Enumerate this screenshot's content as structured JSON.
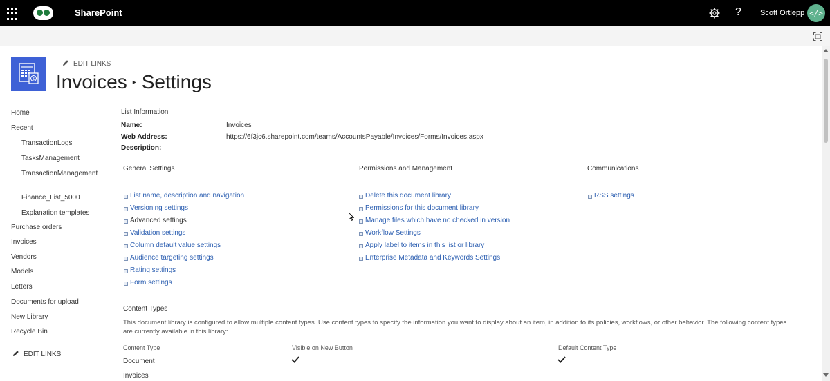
{
  "suite": {
    "app_name": "SharePoint",
    "user_name": "Scott Ortlepp",
    "avatar_glyph": "</>",
    "avatar_color": "#5fb28e"
  },
  "header": {
    "edit_links": "EDIT LINKS",
    "title_parent": "Invoices",
    "title_separator": "▸",
    "title_current": "Settings",
    "site_logo_color": "#3e61d6"
  },
  "nav": {
    "items": [
      {
        "label": "Home"
      },
      {
        "label": "Recent"
      },
      {
        "label": "TransactionLogs"
      },
      {
        "label": "TasksManagement"
      },
      {
        "label": "TransactionManagement"
      },
      {
        "label": "Finance_List_5000"
      },
      {
        "label": "Explanation templates"
      },
      {
        "label": "Purchase orders"
      },
      {
        "label": "Invoices"
      },
      {
        "label": "Vendors"
      },
      {
        "label": "Models"
      },
      {
        "label": "Letters"
      },
      {
        "label": "Documents for upload"
      },
      {
        "label": "New Library"
      },
      {
        "label": "Recycle Bin"
      }
    ],
    "edit_links": "EDIT LINKS"
  },
  "list_info": {
    "title": "List Information",
    "name_label": "Name:",
    "name_value": "Invoices",
    "web_label": "Web Address:",
    "web_value": "https://6f3jc6.sharepoint.com/teams/AccountsPayable/Invoices/Forms/Invoices.aspx",
    "desc_label": "Description:"
  },
  "general_settings": {
    "title": "General Settings",
    "links": [
      "List name, description and navigation",
      "Versioning settings",
      "Advanced settings",
      "Validation settings",
      "Column default value settings",
      "Audience targeting settings",
      "Rating settings",
      "Form settings"
    ]
  },
  "permissions": {
    "title": "Permissions and Management",
    "links": [
      "Delete this document library",
      "Permissions for this document library",
      "Manage files which have no checked in version",
      "Workflow Settings",
      "Apply label to items in this list or library",
      "Enterprise Metadata and Keywords Settings"
    ]
  },
  "communications": {
    "title": "Communications",
    "links": [
      "RSS settings"
    ]
  },
  "content_types": {
    "title": "Content Types",
    "description": "This document library is configured to allow multiple content types. Use content types to specify the information you want to display about an item, in addition to its policies, workflows, or other behavior. The following content types are currently available in this library:",
    "columns": [
      "Content Type",
      "Visible on New Button",
      "Default Content Type"
    ],
    "rows": [
      {
        "name": "Document",
        "visible": true,
        "default": true
      },
      {
        "name": "Invoices",
        "visible": false,
        "default": false
      }
    ]
  }
}
